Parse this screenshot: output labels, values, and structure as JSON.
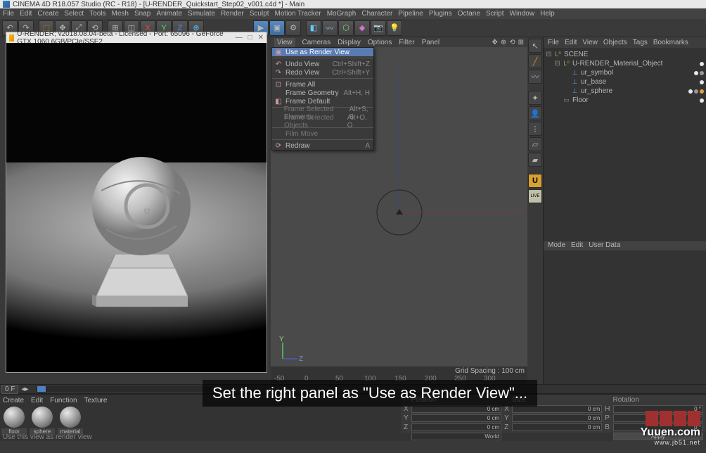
{
  "title": "CINEMA 4D R18.057 Studio (RC - R18) - [U-RENDER_Quickstart_Step02_v001.c4d *] - Main",
  "menubar": [
    "File",
    "Edit",
    "Create",
    "Select",
    "Tools",
    "Mesh",
    "Snap",
    "Animate",
    "Simulate",
    "Render",
    "Sculpt",
    "Motion Tracker",
    "MoGraph",
    "Character",
    "Pipeline",
    "Plugins",
    "Octane",
    "Script",
    "Window",
    "Help"
  ],
  "subwin_title": "U-RENDER; v2018.08.04-beta - Licensed - Port: 65096 - GeForce GTX 1060 6GB/PCIe/SSE2 ...",
  "vpmenu": [
    "View",
    "Cameras",
    "Display",
    "Options",
    "Filter",
    "Panel"
  ],
  "vpstatus": "Grid Spacing : 100 cm",
  "ruler": [
    {
      "p": 5,
      "t": "-50"
    },
    {
      "p": 48,
      "t": "0"
    },
    {
      "p": 92,
      "t": "50"
    },
    {
      "p": 133,
      "t": "100"
    },
    {
      "p": 176,
      "t": "150"
    },
    {
      "p": 219,
      "t": "200"
    },
    {
      "p": 261,
      "t": "250"
    },
    {
      "p": 303,
      "t": "300"
    }
  ],
  "dropdown": [
    {
      "type": "item",
      "label": "Use as Render View",
      "sel": true,
      "icon": "▣"
    },
    {
      "type": "sep"
    },
    {
      "type": "item",
      "label": "Undo View",
      "kb": "Ctrl+Shift+Z",
      "icon": "↶"
    },
    {
      "type": "item",
      "label": "Redo View",
      "kb": "Ctrl+Shift+Y",
      "icon": "↷"
    },
    {
      "type": "sep"
    },
    {
      "type": "item",
      "label": "Frame All",
      "icon": "⊡"
    },
    {
      "type": "item",
      "label": "Frame Geometry",
      "kb": "Alt+H, H"
    },
    {
      "type": "item",
      "label": "Frame Default",
      "icon": "◧"
    },
    {
      "type": "sep"
    },
    {
      "type": "item",
      "label": "Frame Selected Elements",
      "kb": "Alt+S, S",
      "dis": true
    },
    {
      "type": "item",
      "label": "Frame Selected Objects",
      "kb": "Alt+O, O",
      "dis": true
    },
    {
      "type": "sep"
    },
    {
      "type": "item",
      "label": "Film Move",
      "dis": true
    },
    {
      "type": "sep"
    },
    {
      "type": "item",
      "label": "Redraw",
      "kb": "A",
      "icon": "⟳"
    }
  ],
  "objmenu": [
    "File",
    "Edit",
    "View",
    "Objects",
    "Tags",
    "Bookmarks"
  ],
  "tree": [
    {
      "ind": 0,
      "tog": "⊟",
      "icon": "L⁰",
      "ic": "#7fb766",
      "label": "SCENE"
    },
    {
      "ind": 12,
      "tog": "⊟",
      "icon": "L⁰",
      "ic": "#7fb766",
      "label": "U-RENDER_Material_Object",
      "tags": [
        "#e8e8e8"
      ]
    },
    {
      "ind": 24,
      "tog": "",
      "icon": "⊥",
      "ic": "#6aa0e0",
      "label": "ur_symbol",
      "tags": [
        "#e8e8e8",
        "#999"
      ]
    },
    {
      "ind": 24,
      "tog": "",
      "icon": "⊥",
      "ic": "#6aa0e0",
      "label": "ur_base",
      "tags": [
        "#e8e8e8"
      ]
    },
    {
      "ind": 24,
      "tog": "",
      "icon": "⊥",
      "ic": "#6aa0e0",
      "label": "ur_sphere",
      "tags": [
        "#e8e8e8",
        "#999",
        "#e8a040"
      ]
    },
    {
      "ind": 12,
      "tog": "",
      "icon": "▭",
      "ic": "#888",
      "label": "Floor",
      "tags": [
        "#e8e8e8"
      ]
    }
  ],
  "attrmenu": [
    "Mode",
    "Edit",
    "User Data"
  ],
  "timeline_frame": "0 F",
  "matmenu": [
    "Create",
    "Edit",
    "Function",
    "Texture"
  ],
  "materials": [
    "floor",
    "sphere",
    "material"
  ],
  "coords": {
    "hdr": [
      "Position",
      "Size",
      "Rotation"
    ],
    "rows": [
      [
        "X",
        "0 cm",
        "X",
        "0 cm",
        "H",
        "0 °"
      ],
      [
        "Y",
        "0 cm",
        "Y",
        "0 cm",
        "P",
        "0 °"
      ],
      [
        "Z",
        "0 cm",
        "Z",
        "0 cm",
        "B",
        "0 °"
      ]
    ],
    "apply": "Apply",
    "dropdown": "World"
  },
  "status": "Use this view as render view",
  "axis": {
    "y": "Y",
    "z": "Z"
  },
  "caption": "Set the right panel as \"Use as Render View\"...",
  "wm": {
    "t1": "Yuuen.com",
    "t2": "www.jb51.net"
  }
}
